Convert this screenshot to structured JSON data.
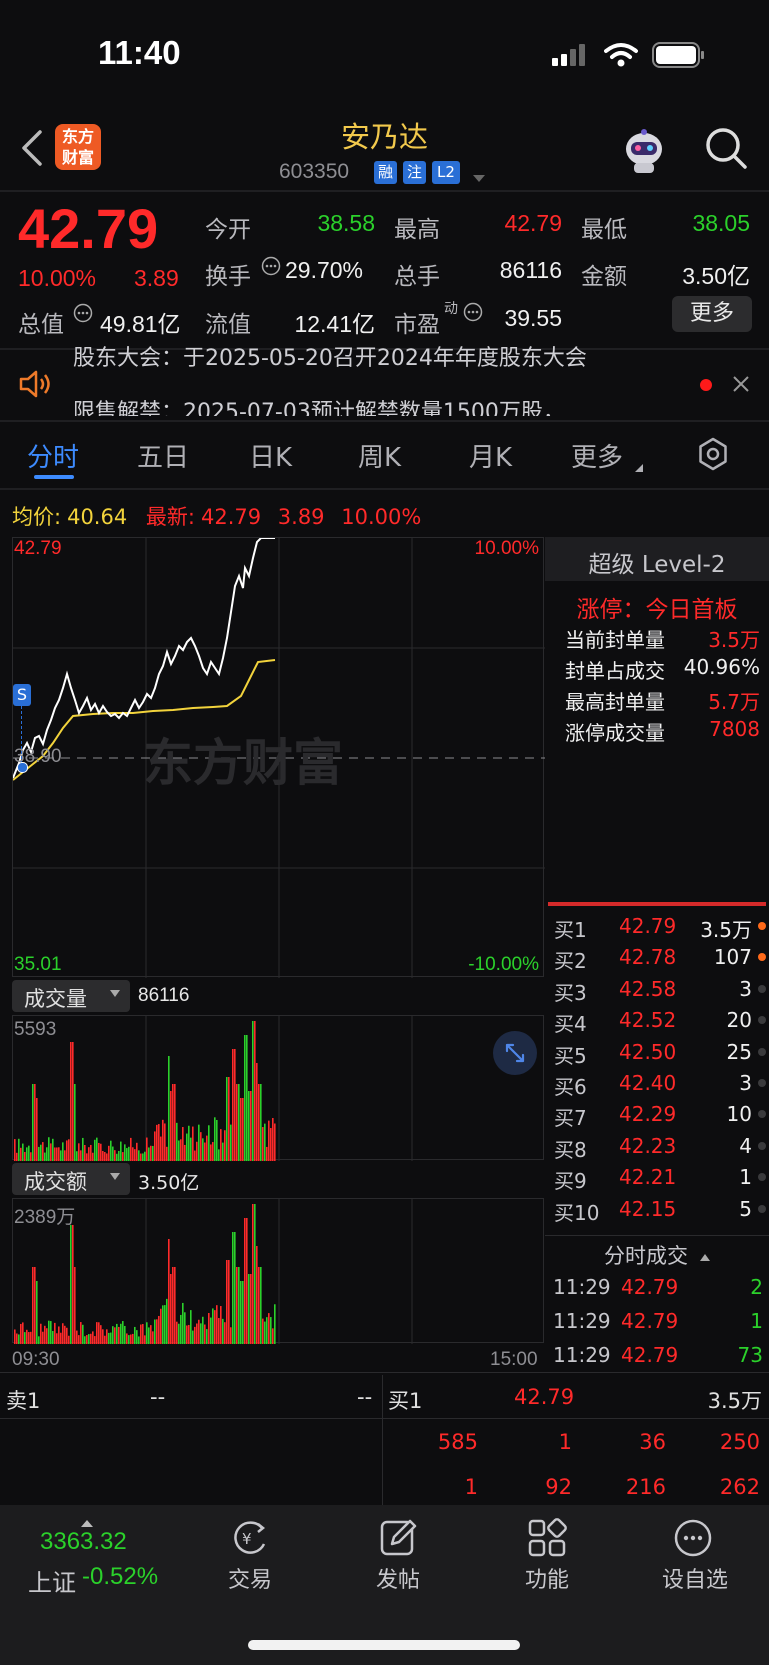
{
  "status_bar": {
    "time": "11:40"
  },
  "header": {
    "logo_text_line1": "东方",
    "logo_text_line2": "财富",
    "stock_name": "安乃达",
    "stock_code": "603350",
    "tags": [
      "融",
      "注",
      "L2"
    ]
  },
  "quote": {
    "last_price": "42.79",
    "change_pct": "10.00%",
    "change_amt": "3.89",
    "open_label": "今开",
    "open": "38.58",
    "high_label": "最高",
    "high": "42.79",
    "low_label": "最低",
    "low": "38.05",
    "turnover_label": "换手",
    "turnover": "29.70%",
    "volume_label": "总手",
    "volume": "86116",
    "amount_label": "金额",
    "amount": "3.50亿",
    "mcap_label": "总值",
    "mcap": "49.81亿",
    "float_label": "流值",
    "float": "12.41亿",
    "pe_label": "市盈",
    "pe_sup": "动",
    "pe": "39.55",
    "more_label": "更多"
  },
  "notices": [
    "股东大会：于2025-05-20召开2024年年度股东大会",
    "限售解禁：2025-07-03预计解禁数量1500万股，..."
  ],
  "tabs": [
    "分时",
    "五日",
    "日K",
    "周K",
    "月K",
    "更多"
  ],
  "info_line": {
    "avg_label": "均价:",
    "avg": "40.64",
    "latest_label": "最新:",
    "latest": "42.79",
    "chg": "3.89",
    "pct": "10.00%"
  },
  "chart": {
    "y_top": "42.79",
    "y_mid": "38.90",
    "y_bottom": "35.01",
    "pct_top": "10.00%",
    "pct_bottom": "-10.00%",
    "watermark": "东方财富",
    "s_marker": "S",
    "volume_label": "成交量",
    "volume_value": "86116",
    "volume_max": "5593",
    "amount_label": "成交额",
    "amount_value": "3.50亿",
    "amount_max": "2389万",
    "time_start": "09:30",
    "time_end": "15:00",
    "colors": {
      "price": "#ffffff",
      "avg": "#f2d33c",
      "up": "#ff2a2a",
      "down": "#2bd12b"
    }
  },
  "level2": {
    "title": "超级 Level-2",
    "limit_status": "涨停：今日首板",
    "rows": [
      {
        "label": "当前封单量",
        "value": "3.5万",
        "color": "red"
      },
      {
        "label": "封单占成交",
        "value": "40.96%",
        "color": "white"
      },
      {
        "label": "最高封单量",
        "value": "5.7万",
        "color": "red"
      },
      {
        "label": "涨停成交量",
        "value": "7808",
        "color": "red"
      }
    ]
  },
  "bids": [
    {
      "label": "买1",
      "price": "42.79",
      "qty": "3.5万",
      "dot": true
    },
    {
      "label": "买2",
      "price": "42.78",
      "qty": "107",
      "dot": true
    },
    {
      "label": "买3",
      "price": "42.58",
      "qty": "3",
      "dot": false
    },
    {
      "label": "买4",
      "price": "42.52",
      "qty": "20",
      "dot": false
    },
    {
      "label": "买5",
      "price": "42.50",
      "qty": "25",
      "dot": false
    },
    {
      "label": "买6",
      "price": "42.40",
      "qty": "3",
      "dot": false
    },
    {
      "label": "买7",
      "price": "42.29",
      "qty": "10",
      "dot": false
    },
    {
      "label": "买8",
      "price": "42.23",
      "qty": "4",
      "dot": false
    },
    {
      "label": "买9",
      "price": "42.21",
      "qty": "1",
      "dot": false
    },
    {
      "label": "买10",
      "price": "42.15",
      "qty": "5",
      "dot": false
    }
  ],
  "tick_trades": {
    "title": "分时成交",
    "rows": [
      {
        "time": "11:29",
        "price": "42.79",
        "qty": "2"
      },
      {
        "time": "11:29",
        "price": "42.79",
        "qty": "1"
      },
      {
        "time": "11:29",
        "price": "42.79",
        "qty": "73"
      }
    ]
  },
  "queue": {
    "sell_label": "卖1",
    "sell_price": "--",
    "sell_qty": "--",
    "buy_label": "买1",
    "buy_price": "42.79",
    "buy_qty": "3.5万",
    "row1": [
      "585",
      "1",
      "36",
      "250"
    ],
    "row2": [
      "1",
      "92",
      "216",
      "262"
    ]
  },
  "bottom_nav": {
    "index_value": "3363.32",
    "index_name": "上证",
    "index_change": "-0.52%",
    "items": [
      {
        "label": "交易",
        "icon": "yuan-cycle-icon"
      },
      {
        "label": "发帖",
        "icon": "edit-icon"
      },
      {
        "label": "功能",
        "icon": "grid-icon"
      },
      {
        "label": "设自选",
        "icon": "more-circle-icon"
      }
    ]
  }
}
